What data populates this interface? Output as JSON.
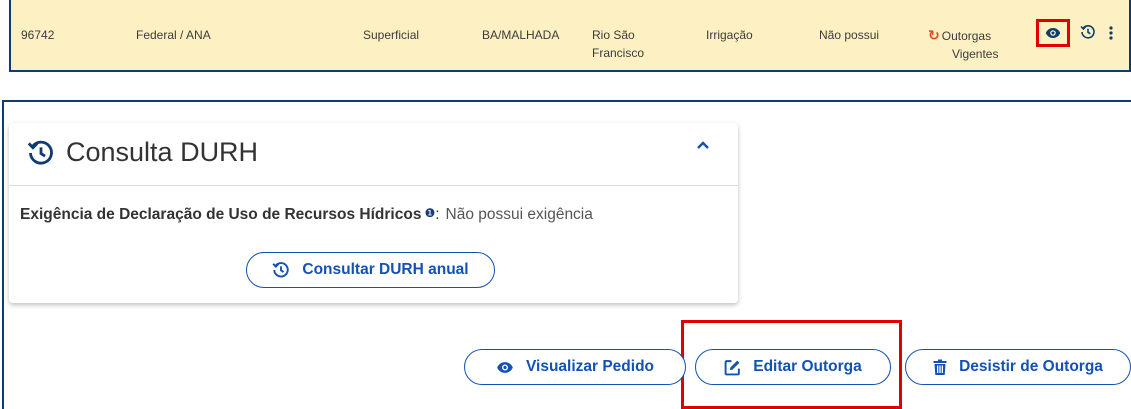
{
  "row": {
    "id": "96742",
    "jurisdiction": "Federal / ANA",
    "water_type": "Superficial",
    "location": "BA/MALHADA",
    "basin_line1": "Rio São",
    "basin_line2": "Francisco",
    "purpose": "Irrigação",
    "durh": "Não possui",
    "status_line1": "Outorgas",
    "status_line2": "Vigentes",
    "icons": [
      "refresh-icon",
      "eye-icon",
      "history-icon",
      "more-vertical-icon"
    ]
  },
  "card": {
    "title": "Consulta DURH",
    "requirement_label": "Exigência de Declaração de Uso de Recursos Hídricos",
    "requirement_value": "Não possui exigência",
    "consult_button": "Consultar DURH anual",
    "icons": [
      "history-icon",
      "chevron-up-icon",
      "info-icon"
    ]
  },
  "actions": {
    "view_label": "Visualizar Pedido",
    "edit_label": "Editar Outorga",
    "quit_label": "Desistir de Outorga"
  },
  "colors": {
    "row_bg": "#fdf1c4",
    "frame_border": "#0c3d6e",
    "primary_blue": "#1351b4",
    "highlight_red": "#e10000",
    "status_orange": "#e04a1f"
  }
}
